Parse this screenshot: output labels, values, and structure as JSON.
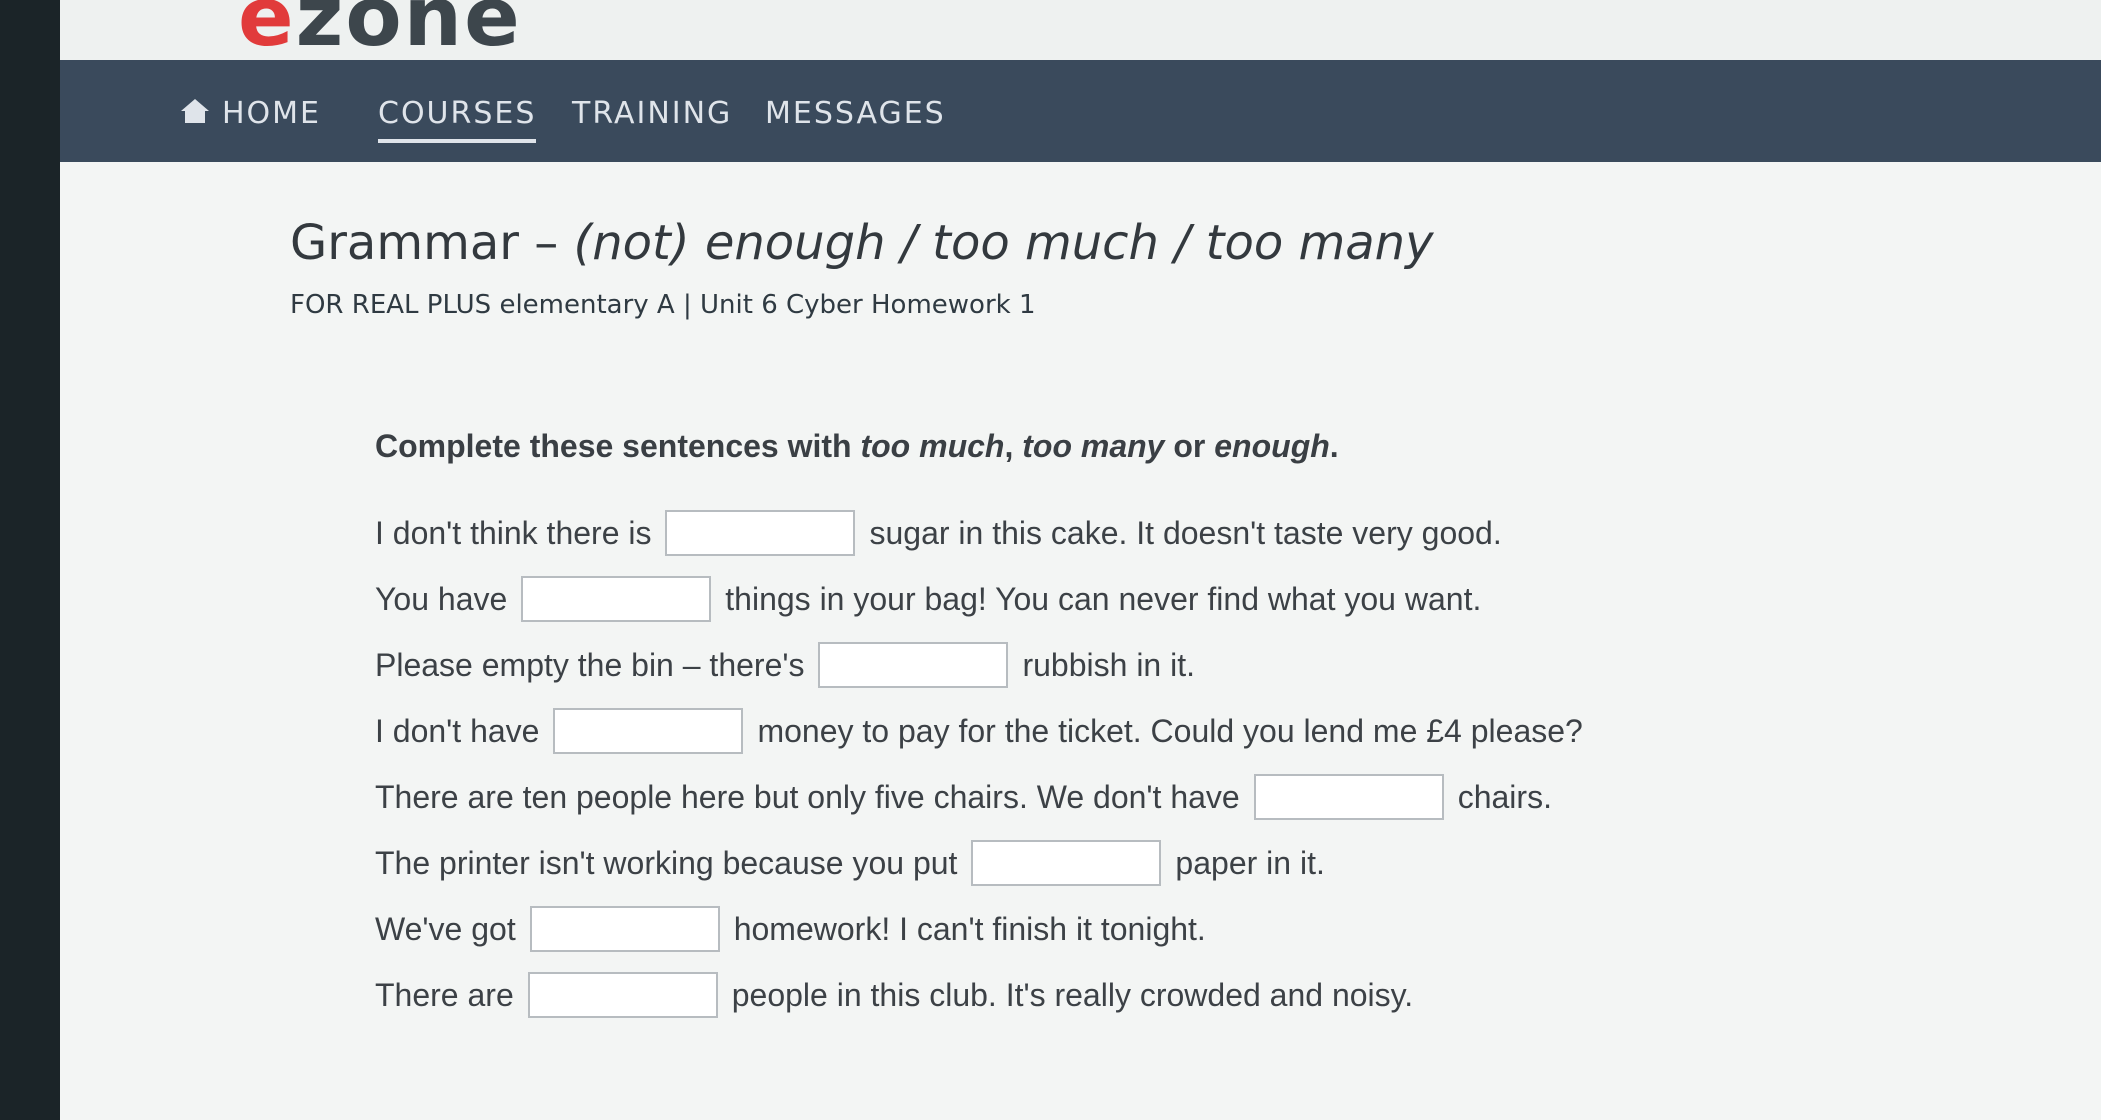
{
  "logo": {
    "e": "e",
    "rest": "zone"
  },
  "nav": {
    "items": [
      {
        "label": "HOME",
        "icon": "home-icon"
      },
      {
        "label": "COURSES",
        "active": true
      },
      {
        "label": "TRAINING"
      },
      {
        "label": "MESSAGES"
      }
    ]
  },
  "page": {
    "title_prefix": "Grammar – ",
    "title_italic": "(not) enough / too much / too many",
    "subtitle": "FOR REAL PLUS elementary A | Unit 6 Cyber Homework 1"
  },
  "instruction": {
    "before": "Complete these sentences with ",
    "opt1": "too much",
    "sep1": ", ",
    "opt2": "too many",
    "sep2": " or ",
    "opt3": "enough",
    "after": "."
  },
  "sentences": [
    {
      "before": "I don't think there is",
      "value": "",
      "after": "sugar in this cake. It doesn't taste very good."
    },
    {
      "before": "You have",
      "value": "",
      "after": "things in your bag! You can never find what you want."
    },
    {
      "before": "Please empty the bin – there's",
      "value": "",
      "after": "rubbish in it."
    },
    {
      "before": "I don't have",
      "value": "",
      "after": "money to pay for the ticket. Could you lend me £4 please?"
    },
    {
      "before": "There are ten people here but only five chairs. We don't have",
      "value": "",
      "after": "chairs."
    },
    {
      "before": "The printer isn't working because you put",
      "value": "",
      "after": "paper in it."
    },
    {
      "before": "We've got",
      "value": "",
      "after": "homework! I can't finish it tonight."
    },
    {
      "before": "There are",
      "value": "",
      "after": "people in this club. It's really crowded and noisy."
    }
  ],
  "colors": {
    "navbar": "#3a4a5c",
    "logo_dot": "#e13b3b",
    "background": "#f3f5f4"
  }
}
